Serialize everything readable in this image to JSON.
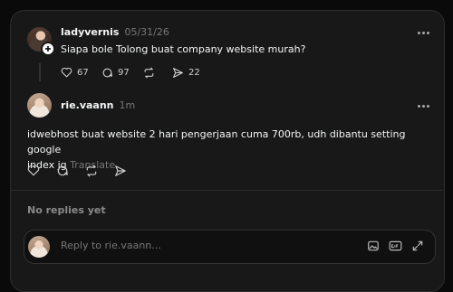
{
  "post": {
    "username": "ladyvernis",
    "date": "05/31/26",
    "text": "Siapa bole Tolong buat company website murah?",
    "likes": "67",
    "comments": "97",
    "shares": "22"
  },
  "reply": {
    "username": "rie.vaann",
    "time": "1m",
    "text_line1": "idwebhost buat website 2 hari pengerjaan cuma 700rb, udh dibantu setting google",
    "text_line2": "index jg",
    "translate_label": "Translate"
  },
  "no_replies": "No replies yet",
  "composer": {
    "placeholder": "Reply to rie.vaann..."
  },
  "icons": {
    "more": "more-icon",
    "like": "heart-icon",
    "comment": "comment-icon",
    "repost": "repost-icon",
    "share": "send-icon",
    "gif": "gif-icon",
    "image": "image-icon",
    "expand": "expand-icon"
  }
}
